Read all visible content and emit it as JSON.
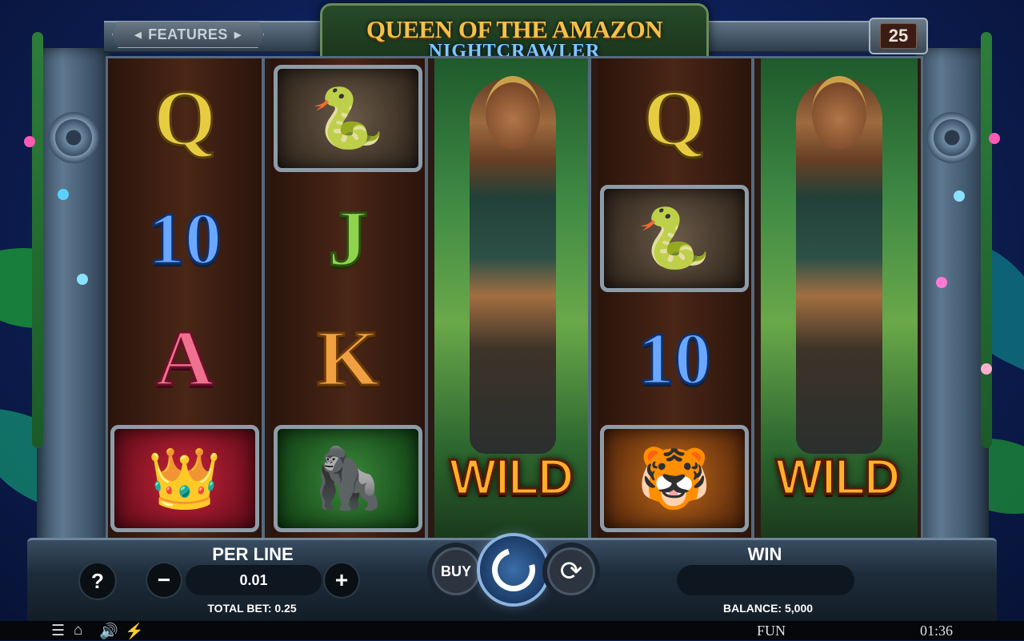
{
  "game": {
    "title_line1": "QUEEN OF THE AMAZON",
    "title_line2": "NIGHTCRAWLER"
  },
  "top_bar": {
    "features_label": "FEATURES",
    "lines_count": "25"
  },
  "reels": [
    [
      "Q",
      "10",
      "A",
      "crown"
    ],
    [
      "snake",
      "J",
      "K",
      "gorilla"
    ],
    [
      "queen-wild"
    ],
    [
      "Q",
      "snake",
      "10",
      "tiger"
    ],
    [
      "queen-wild"
    ]
  ],
  "wild_label": "WILD",
  "controls": {
    "help_label": "?",
    "per_line_label": "PER LINE",
    "per_line_value": "0.01",
    "minus_label": "−",
    "plus_label": "+",
    "total_bet_label": "TOTAL BET: 0.25",
    "buy_label": "BUY",
    "win_label": "WIN",
    "win_value": "",
    "balance_label": "BALANCE: 5,000"
  },
  "footer": {
    "mode": "FUN",
    "clock": "01:36"
  },
  "colors": {
    "background": "#0d1f55",
    "title_gold": "#f3c14b",
    "subtitle_blue": "#7fc8ff",
    "wild_orange": "#ffb02a",
    "spin_blue": "#3a6ea8"
  },
  "icons": [
    "menu-icon",
    "home-icon",
    "sound-icon",
    "turbo-icon",
    "spin-icon",
    "autoplay-icon"
  ]
}
